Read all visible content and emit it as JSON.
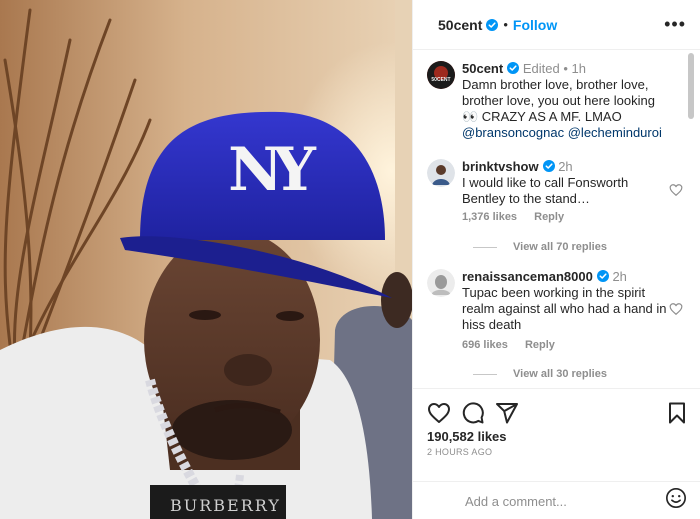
{
  "post": {
    "author": "50cent",
    "follow_label": "Follow",
    "more_label": "•••",
    "dot": "•"
  },
  "caption": {
    "username": "50cent",
    "edited": "Edited",
    "sep": "•",
    "time": "1h",
    "text": "Damn brother love, brother love, brother love, you out here looking 👀 CRAZY AS A MF. LMAO",
    "mention1": "@bransoncognac",
    "mention2": "@lecheminduroi",
    "avatar_text": "50CENT"
  },
  "comments": [
    {
      "username": "brinktvshow",
      "time": "2h",
      "text": "I would like to call Fonsworth Bentley to the stand…",
      "likes": "1,376 likes",
      "reply_label": "Reply",
      "view_replies": "View all 70 replies"
    },
    {
      "username": "renaissanceman8000",
      "time": "2h",
      "text": "Tupac been working in the spirit realm against all who had a hand in hiss death",
      "likes": "696 likes",
      "reply_label": "Reply",
      "view_replies": "View all 30 replies"
    }
  ],
  "footer": {
    "likes": "190,582 likes",
    "ago": "2 HOURS AGO",
    "add_comment_placeholder": "Add a comment..."
  },
  "photo": {
    "cap_logo": "NY",
    "shirt_text": "BURBERRY"
  },
  "colors": {
    "link_blue": "#0095f6",
    "mention_blue": "#00376b",
    "cap_blue": "#2b2ec0"
  },
  "icons": [
    "verified-badge-icon",
    "more-icon",
    "heart-icon",
    "comment-icon",
    "share-icon",
    "bookmark-icon",
    "emoji-icon"
  ]
}
